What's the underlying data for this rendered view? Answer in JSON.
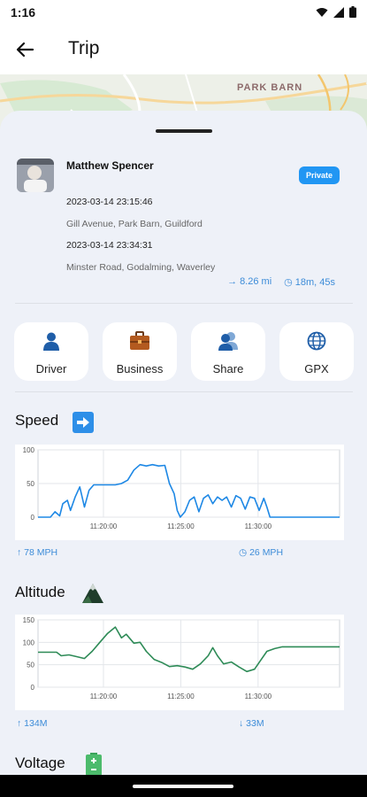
{
  "status": {
    "time": "1:16"
  },
  "appbar": {
    "title": "Trip"
  },
  "map": {
    "label": "PARK BARN"
  },
  "trip": {
    "driver_name": "Matthew Spencer",
    "badge": "Private",
    "start_time": "2023-03-14 23:15:46",
    "start_address": "Gill Avenue,  Park Barn,  Guildford",
    "end_time": "2023-03-14 23:34:31",
    "end_address": "Minster Road,  Godalming,  Waverley",
    "distance": "8.26 mi",
    "duration": "18m, 45s"
  },
  "actions": [
    {
      "label": "Driver",
      "icon": "person-icon"
    },
    {
      "label": "Business",
      "icon": "briefcase-icon"
    },
    {
      "label": "Share",
      "icon": "share-people-icon"
    },
    {
      "label": "GPX",
      "icon": "globe-icon"
    }
  ],
  "speed": {
    "title": "Speed",
    "max": "78 MPH",
    "avg": "26 MPH"
  },
  "altitude": {
    "title": "Altitude",
    "max": "134M",
    "min": "33M"
  },
  "voltage": {
    "title": "Voltage"
  },
  "colors": {
    "accent": "#2196f3",
    "speed_line": "#1e88e5",
    "altitude_line": "#2e8b57"
  },
  "chart_data": [
    {
      "type": "line",
      "title": "Speed",
      "ylim": [
        0,
        100
      ],
      "yticks": [
        "0",
        "50",
        "100"
      ],
      "xticks": [
        "11:20:00",
        "11:25:00",
        "11:30:00"
      ],
      "xtick_minutes": [
        4.23,
        9.23,
        14.23
      ],
      "xlim_minutes": [
        0,
        19.5
      ],
      "grid": true,
      "series": [
        {
          "x": [
            0,
            0.8,
            1.1,
            1.4,
            1.6,
            1.9,
            2.1,
            2.4,
            2.7,
            3.0,
            3.3,
            3.6,
            3.9,
            4.2,
            4.6,
            5.0,
            5.4,
            5.8,
            6.2,
            6.6,
            7.0,
            7.4,
            7.8,
            8.2,
            8.5,
            8.8,
            9.0,
            9.2,
            9.5,
            9.8,
            10.1,
            10.4,
            10.7,
            11.0,
            11.3,
            11.6,
            11.9,
            12.2,
            12.5,
            12.8,
            13.1,
            13.4,
            13.7,
            14.0,
            14.3,
            14.6,
            14.8,
            15.0,
            15.2,
            15.5,
            19.5
          ],
          "values": [
            0,
            0,
            8,
            2,
            20,
            25,
            10,
            30,
            45,
            15,
            40,
            48,
            48,
            48,
            48,
            48,
            50,
            55,
            70,
            78,
            76,
            78,
            76,
            77,
            50,
            35,
            10,
            0,
            8,
            25,
            30,
            8,
            28,
            33,
            20,
            30,
            25,
            30,
            15,
            32,
            28,
            12,
            30,
            28,
            10,
            28,
            15,
            0,
            0,
            0,
            0
          ]
        }
      ]
    },
    {
      "type": "line",
      "title": "Altitude",
      "ylim": [
        0,
        150
      ],
      "yticks": [
        "0",
        "50",
        "100",
        "150"
      ],
      "xticks": [
        "11:20:00",
        "11:25:00",
        "11:30:00"
      ],
      "xtick_minutes": [
        4.23,
        9.23,
        14.23
      ],
      "xlim_minutes": [
        0,
        19.5
      ],
      "grid": true,
      "series": [
        {
          "x": [
            0,
            1.2,
            1.5,
            2.0,
            2.5,
            3.0,
            3.5,
            4.0,
            4.5,
            5.0,
            5.4,
            5.7,
            6.2,
            6.6,
            7.0,
            7.5,
            8.0,
            8.5,
            9.0,
            9.5,
            10.0,
            10.5,
            11.0,
            11.3,
            11.6,
            12.0,
            12.5,
            13.0,
            13.5,
            14.0,
            14.4,
            14.8,
            15.3,
            15.8,
            16.5,
            19.5
          ],
          "values": [
            78,
            78,
            70,
            72,
            68,
            64,
            80,
            100,
            120,
            134,
            110,
            118,
            98,
            100,
            80,
            62,
            55,
            46,
            48,
            45,
            40,
            52,
            70,
            88,
            70,
            52,
            56,
            45,
            35,
            40,
            60,
            80,
            86,
            90,
            90,
            90
          ]
        }
      ]
    }
  ]
}
